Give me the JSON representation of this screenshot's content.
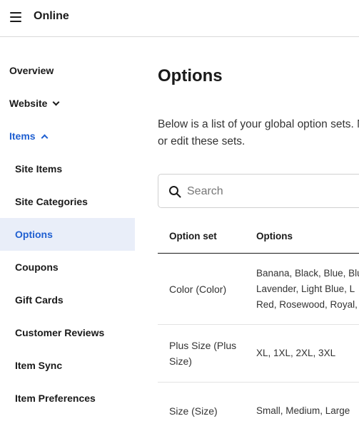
{
  "header": {
    "title": "Online",
    "menu_icon": "hamburger-icon"
  },
  "sidebar": {
    "items": [
      {
        "label": "Overview"
      },
      {
        "label": "Website",
        "icon": "chevron-down-icon"
      },
      {
        "label": "Items",
        "icon": "chevron-up-icon"
      },
      {
        "label": "Site Items"
      },
      {
        "label": "Site Categories"
      },
      {
        "label": "Options"
      },
      {
        "label": "Coupons"
      },
      {
        "label": "Gift Cards"
      },
      {
        "label": "Customer Reviews"
      },
      {
        "label": "Item Sync"
      },
      {
        "label": "Item Preferences"
      }
    ]
  },
  "main": {
    "title": "Options",
    "description": "Below is a list of your global option sets. Manage or edit these sets.",
    "search": {
      "placeholder": "Search",
      "value": ""
    },
    "table": {
      "columns": [
        "Option set",
        "Options"
      ],
      "rows": [
        {
          "option_set": "Color (Color)",
          "options": [
            "Banana, Black, Blue, Blu",
            "Lavender, Light Blue, L",
            "Red, Rosewood, Royal,"
          ]
        },
        {
          "option_set": "Plus Size (Plus Size)",
          "options": [
            "XL, 1XL, 2XL, 3XL"
          ]
        },
        {
          "option_set": "Size (Size)",
          "options": [
            "Small, Medium, Large"
          ]
        }
      ]
    }
  },
  "colors": {
    "accent": "#1f5fd1",
    "active_bg": "#e9eef9",
    "text": "#1a1a1a",
    "border": "#d9d9d9"
  }
}
